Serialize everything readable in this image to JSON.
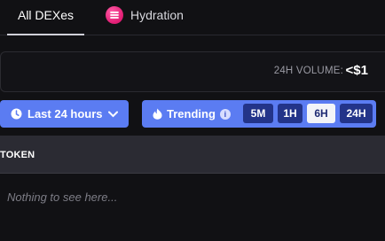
{
  "tabs": [
    {
      "label": "All DEXes",
      "active": true
    },
    {
      "label": "Hydration",
      "icon": "hydration-logo-icon"
    }
  ],
  "volume": {
    "label": "24H VOLUME:",
    "value": "<$1"
  },
  "filters": {
    "time_range": {
      "label": "Last 24 hours",
      "icon": "clock-icon"
    },
    "trending": {
      "label": "Trending",
      "icon": "flame-icon",
      "info_icon": "info-icon",
      "options": [
        "5M",
        "1H",
        "6H",
        "24H"
      ],
      "selected": "6H"
    }
  },
  "table": {
    "columns": [
      "TOKEN"
    ],
    "empty_message": "Nothing to see here..."
  },
  "colors": {
    "accent": "#5b7cf2",
    "option_bg": "#233489",
    "hydration_pink": "#e11d74",
    "background": "#111114"
  }
}
